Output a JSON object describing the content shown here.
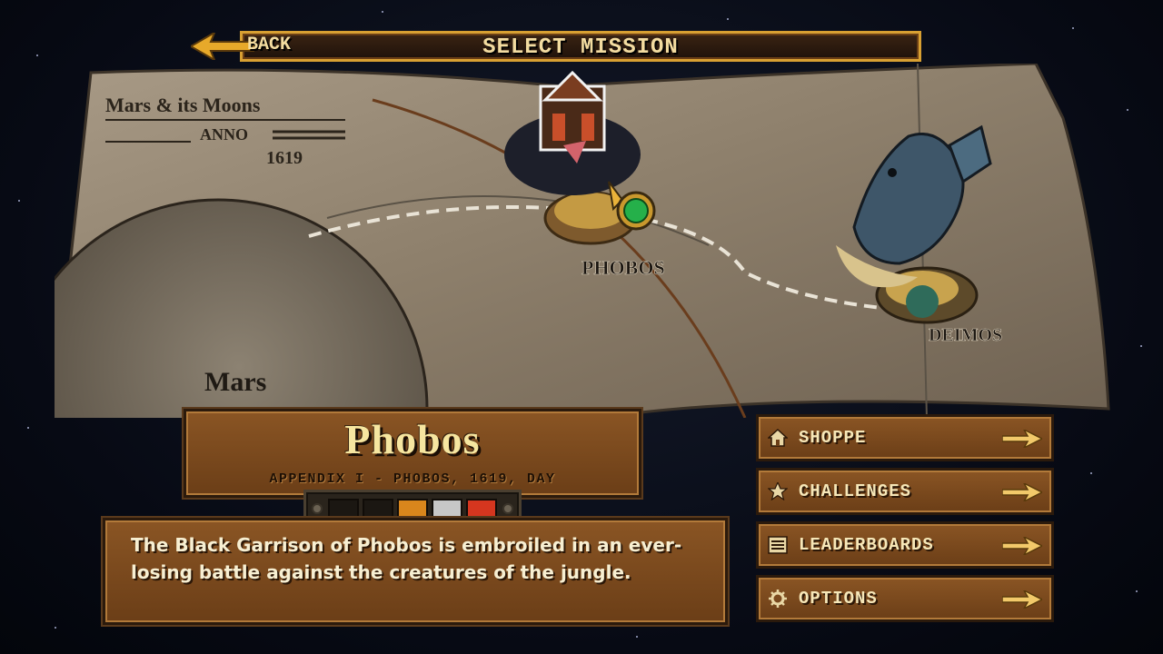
{
  "header": {
    "back_label": "BACK",
    "title": "SELECT MISSION"
  },
  "map": {
    "title_line1": "Mars & its Moons",
    "title_line2": "ANNO",
    "year": "1619",
    "planet_label": "Mars",
    "phobos_label": "PHOBOS",
    "deimos_label": "DEIMOS"
  },
  "mission": {
    "title": "Phobos",
    "subtitle": "APPENDIX I - PHOBOS, 1619, DAY",
    "description": "The Black Garrison of Phobos is embroiled in an ever-losing battle against the creatures of the jungle.",
    "medals": [
      {
        "state": "empty",
        "color": "#1b1712"
      },
      {
        "state": "empty",
        "color": "#1b1712"
      },
      {
        "state": "bronze",
        "color": "#d9861c"
      },
      {
        "state": "silver",
        "color": "#c7c7c7"
      },
      {
        "state": "gold-red",
        "color": "#d5361f"
      }
    ]
  },
  "menu": {
    "items": [
      {
        "label": "SHOPPE",
        "icon": "house-icon"
      },
      {
        "label": "CHALLENGES",
        "icon": "star-icon"
      },
      {
        "label": "LEADERBOARDS",
        "icon": "list-icon"
      },
      {
        "label": "OPTIONS",
        "icon": "gear-icon"
      }
    ]
  },
  "colors": {
    "gold": "#d8a032",
    "panel_brown": "#7a4a1d",
    "text_cream": "#f6e7b8"
  }
}
